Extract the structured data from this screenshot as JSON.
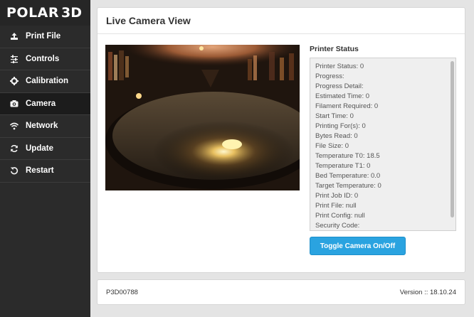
{
  "brand": {
    "name": "POLAR",
    "suffix": "3D"
  },
  "sidebar": {
    "items": [
      {
        "label": "Print File",
        "icon": "upload-icon"
      },
      {
        "label": "Controls",
        "icon": "sliders-icon"
      },
      {
        "label": "Calibration",
        "icon": "gear-icon"
      },
      {
        "label": "Camera",
        "icon": "camera-icon",
        "active": true
      },
      {
        "label": "Network",
        "icon": "wifi-icon"
      },
      {
        "label": "Update",
        "icon": "refresh-icon"
      },
      {
        "label": "Restart",
        "icon": "restart-icon"
      }
    ]
  },
  "main": {
    "title": "Live Camera View",
    "status_title": "Printer Status",
    "status_lines": [
      "Printer Status: 0",
      "Progress:",
      "Progress Detail:",
      "Estimated Time: 0",
      "Filament Required: 0",
      "Start Time: 0",
      "Printing For(s): 0",
      "Bytes Read: 0",
      "File Size: 0",
      "Temperature T0: 18.5",
      "Temperature T1: 0",
      "Bed Temperature: 0.0",
      "Target Temperature: 0",
      "Print Job ID: 0",
      "Print File: null",
      "Print Config: null",
      "Security Code:"
    ],
    "toggle_label": "Toggle Camera On/Off"
  },
  "footer": {
    "serial": "P3D00788",
    "version": "Version :: 18.10.24"
  },
  "colors": {
    "sidebar_bg": "#2b2b2b",
    "accent": "#2aa3e0"
  }
}
